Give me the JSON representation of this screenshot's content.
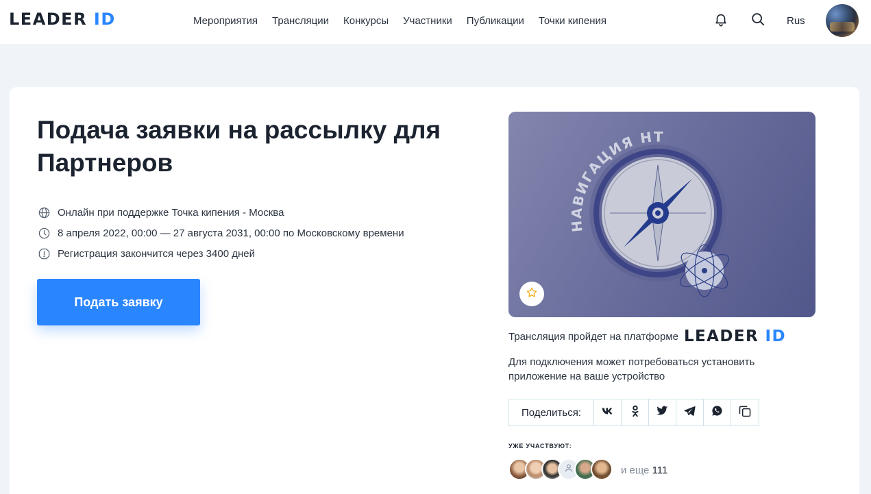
{
  "header": {
    "logo_main": "LEADER",
    "logo_id": "ID",
    "nav": [
      "Мероприятия",
      "Трансляции",
      "Конкурсы",
      "Участники",
      "Публикации",
      "Точки кипения"
    ],
    "lang": "Rus",
    "icons": [
      "bell-icon",
      "search-icon"
    ]
  },
  "event": {
    "title": "Подача заявки на рассылку для Партнеров",
    "location": "Онлайн при поддержке Точка кипения - Москва",
    "dates": "8 апреля 2022, 00:00 — 27 августа 2031, 00:00 по Московскому времени",
    "registration": "Регистрация закончится через 3400 дней",
    "apply_label": "Подать заявку"
  },
  "cover": {
    "arc_text": "НАВИГАЦИЯ НТИ"
  },
  "platform": {
    "text": "Трансляция пройдет на платформе",
    "logo_main": "LEADER",
    "logo_id": "ID",
    "note": "Для подключения может потребоваться установить приложение на ваше устройство"
  },
  "share": {
    "label": "Поделиться:",
    "buttons": [
      "vk-icon",
      "odnoklassniki-icon",
      "twitter-icon",
      "telegram-icon",
      "whatsapp-icon",
      "copy-icon"
    ]
  },
  "participants": {
    "title": "УЖЕ УЧАСТВУЮТ:",
    "more_prefix": "и еще",
    "more_count": "111"
  },
  "colors": {
    "accent": "#2a86ff",
    "background": "#f0f4f8",
    "text": "#1c2330"
  }
}
